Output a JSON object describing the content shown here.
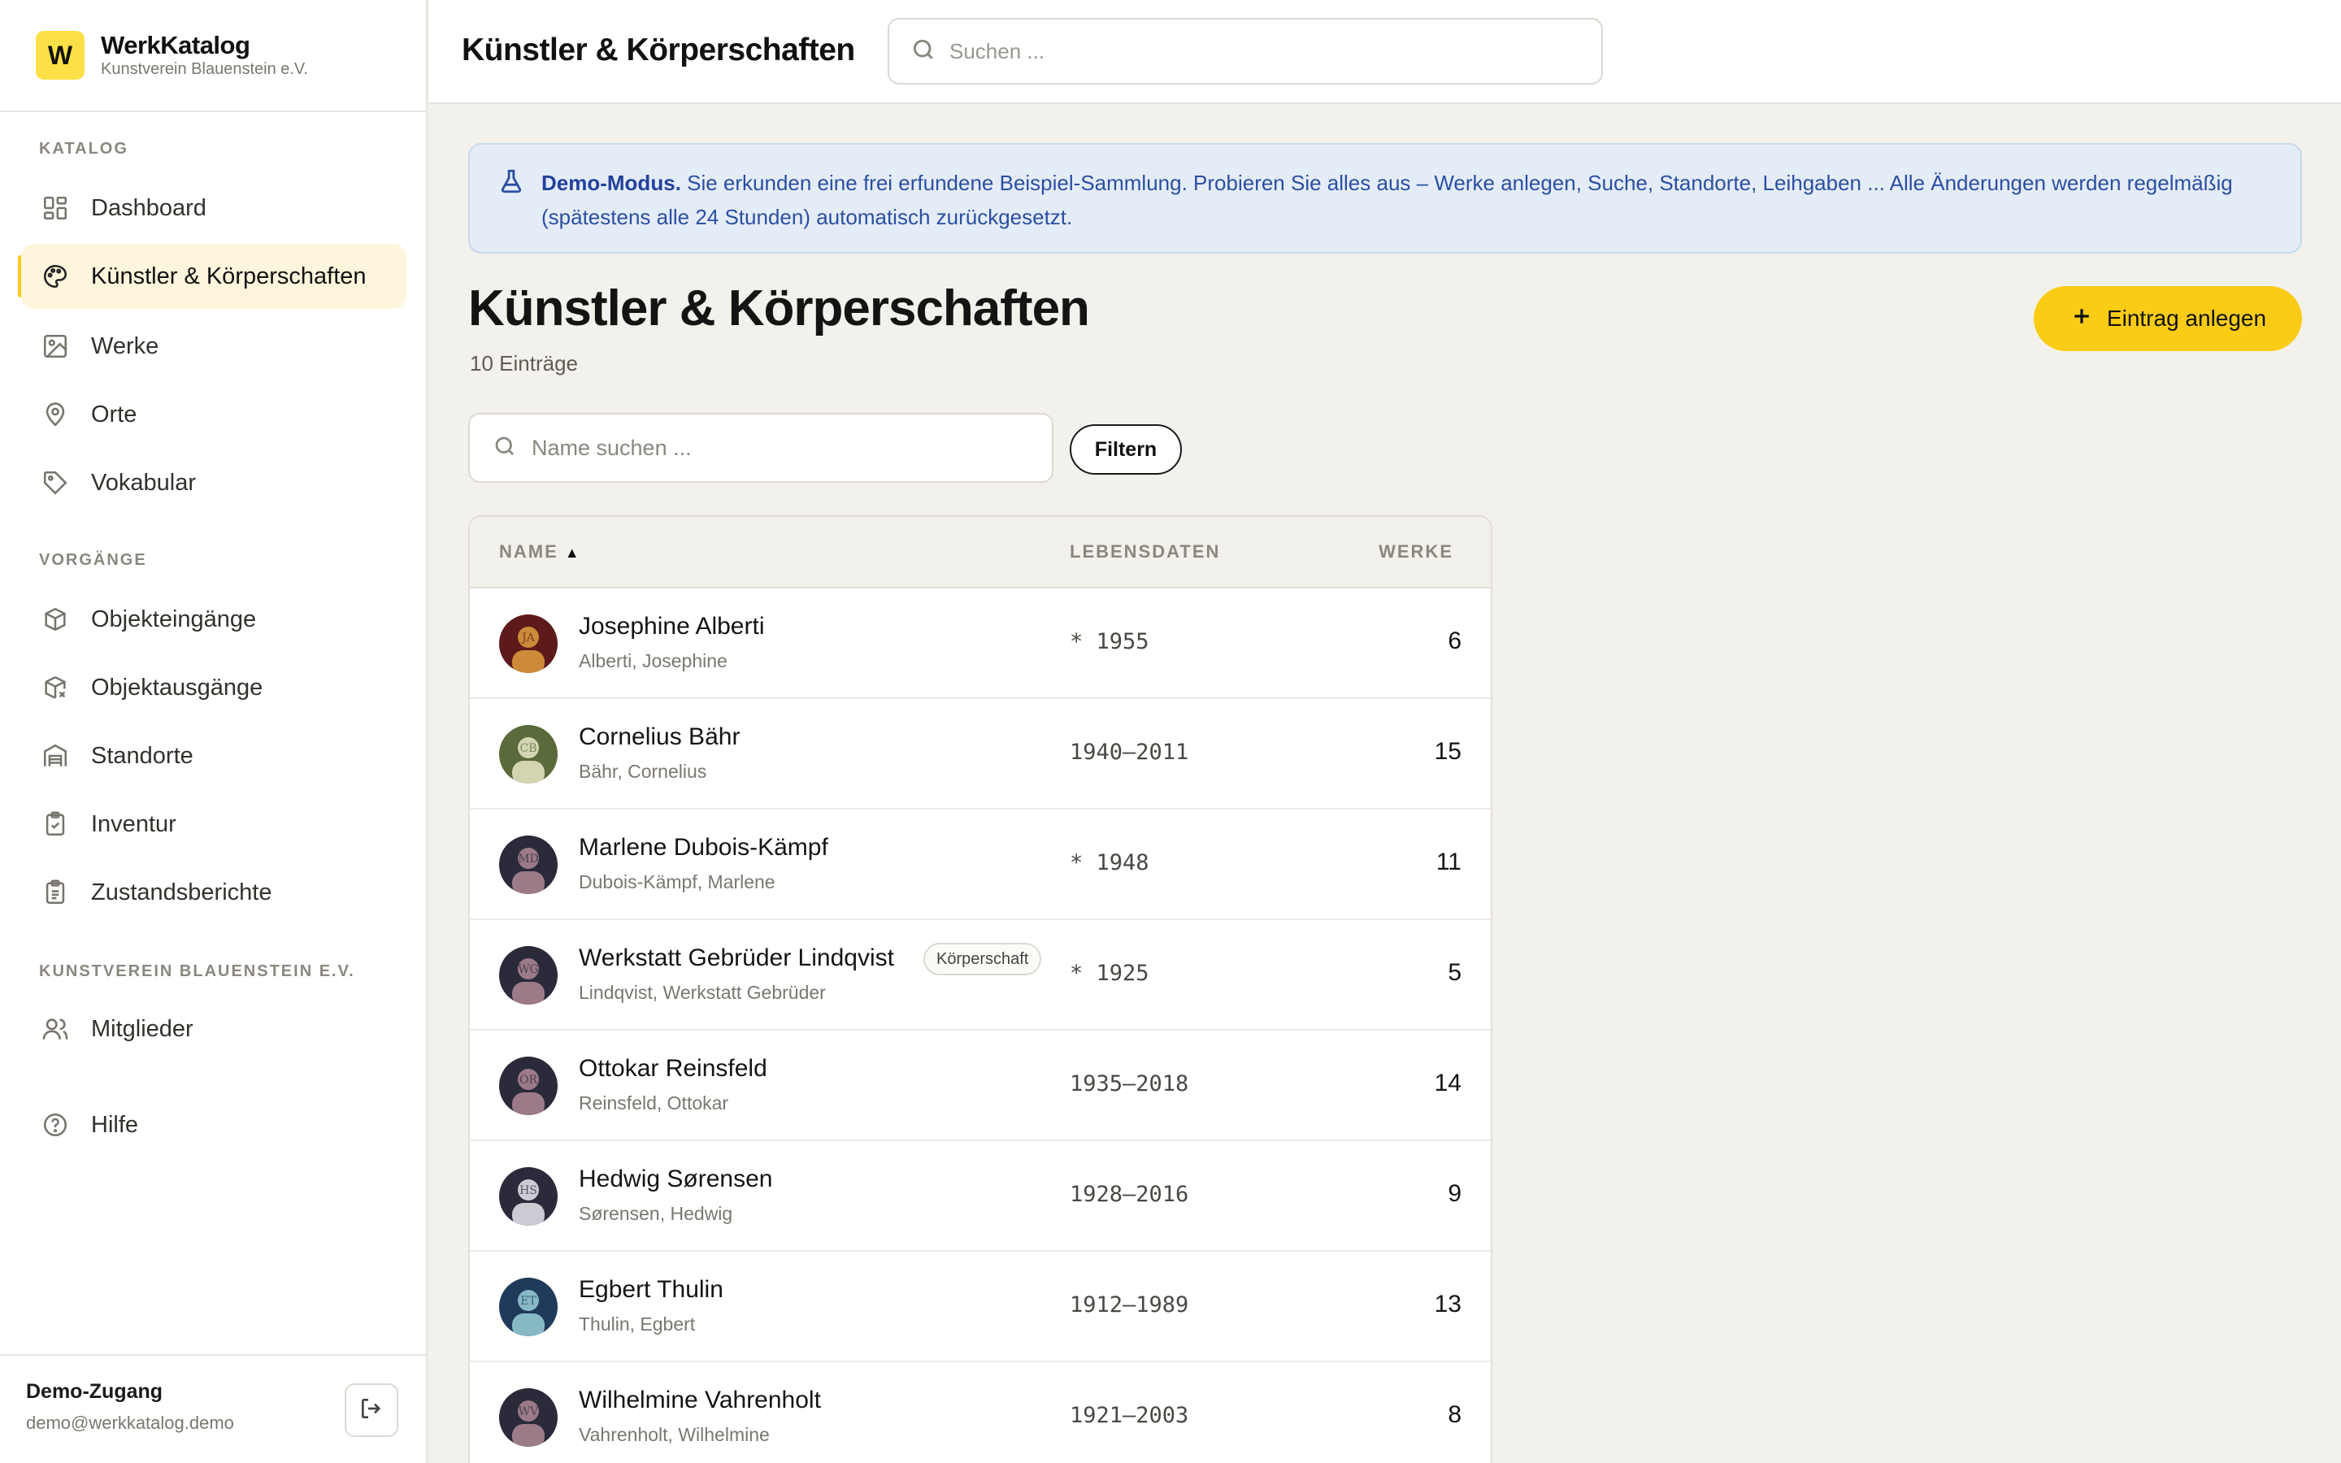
{
  "brand": {
    "logo_letter": "W",
    "name": "WerkKatalog",
    "subtitle": "Kunstverein Blauenstein e.V."
  },
  "sidebar": {
    "sections": [
      {
        "label": "KATALOG"
      },
      {
        "label": "VORGÄNGE"
      },
      {
        "label": "KUNSTVEREIN BLAUENSTEIN E.V."
      }
    ],
    "items": [
      {
        "label": "Dashboard",
        "icon": "dashboard-icon"
      },
      {
        "label": "Künstler & Körperschaften",
        "icon": "palette-icon",
        "active": true
      },
      {
        "label": "Werke",
        "icon": "image-icon"
      },
      {
        "label": "Orte",
        "icon": "map-pin-icon"
      },
      {
        "label": "Vokabular",
        "icon": "tag-icon"
      },
      {
        "label": "Objekteingänge",
        "icon": "package-in-icon"
      },
      {
        "label": "Objektausgänge",
        "icon": "package-out-icon"
      },
      {
        "label": "Standorte",
        "icon": "warehouse-icon"
      },
      {
        "label": "Inventur",
        "icon": "clipboard-check-icon"
      },
      {
        "label": "Zustandsberichte",
        "icon": "clipboard-list-icon"
      },
      {
        "label": "Mitglieder",
        "icon": "users-icon"
      },
      {
        "label": "Hilfe",
        "icon": "help-circle-icon"
      }
    ],
    "user": {
      "name": "Demo-Zugang",
      "email": "demo@werkkatalog.demo"
    }
  },
  "topbar": {
    "title": "Künstler & Körperschaften",
    "search_placeholder": "Suchen ..."
  },
  "banner": {
    "strong": "Demo-Modus.",
    "text": " Sie erkunden eine frei erfundene Beispiel-Sammlung. Probieren Sie alles aus – Werke anlegen, Suche, Standorte, Leihgaben ... Alle Änderungen werden regelmäßig (spätestens alle 24 Stunden) automatisch zurückgesetzt."
  },
  "page": {
    "title": "Künstler & Körperschaften",
    "count": "10 Einträge",
    "add_label": "Eintrag anlegen",
    "name_search_placeholder": "Name suchen ...",
    "filter_label": "Filtern"
  },
  "table": {
    "headers": {
      "name": "NAME",
      "sort": "▲",
      "dates": "LEBENSDATEN",
      "works": "WERKE"
    },
    "rows": [
      {
        "name": "Josephine Alberti",
        "sub": "Alberti, Josephine",
        "dates": "* 1955",
        "works": "6",
        "initials": "JA",
        "bg": "#5c1a1a",
        "fg": "#e0a040"
      },
      {
        "name": "Cornelius Bähr",
        "sub": "Bähr, Cornelius",
        "dates": "1940–2011",
        "works": "15",
        "initials": "CB",
        "bg": "#5a6a3a",
        "fg": "#e8e6c8"
      },
      {
        "name": "Marlene Dubois-Kämpf",
        "sub": "Dubois-Kämpf, Marlene",
        "dates": "* 1948",
        "works": "11",
        "initials": "MD",
        "bg": "#2a2a3a",
        "fg": "#b08a98"
      },
      {
        "name": "Werkstatt Gebrüder Lindqvist",
        "sub": "Lindqvist, Werkstatt Gebrüder",
        "dates": "* 1925",
        "works": "5",
        "badge": "Körperschaft",
        "initials": "WG",
        "bg": "#2a2a3a",
        "fg": "#b08a98"
      },
      {
        "name": "Ottokar Reinsfeld",
        "sub": "Reinsfeld, Ottokar",
        "dates": "1935–2018",
        "works": "14",
        "initials": "OR",
        "bg": "#2a2a3a",
        "fg": "#b08a98"
      },
      {
        "name": "Hedwig Sørensen",
        "sub": "Sørensen, Hedwig",
        "dates": "1928–2016",
        "works": "9",
        "initials": "HS",
        "bg": "#2a2a3a",
        "fg": "#e8e8ee"
      },
      {
        "name": "Egbert Thulin",
        "sub": "Thulin, Egbert",
        "dates": "1912–1989",
        "works": "13",
        "initials": "ET",
        "bg": "#1f3a5a",
        "fg": "#9ad0d8"
      },
      {
        "name": "Wilhelmine Vahrenholt",
        "sub": "Vahrenholt, Wilhelmine",
        "dates": "1921–2003",
        "works": "8",
        "initials": "WV",
        "bg": "#2a2a3a",
        "fg": "#b08a98"
      }
    ]
  }
}
